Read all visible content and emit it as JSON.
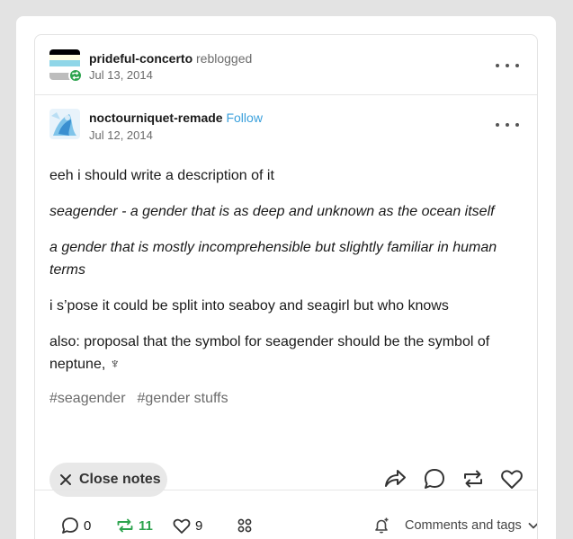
{
  "reblog": {
    "username": "prideful-concerto",
    "action": "reblogged",
    "date": "Jul 13, 2014"
  },
  "original": {
    "username": "noctourniquet-remade",
    "follow_label": "Follow",
    "date": "Jul 12, 2014"
  },
  "post": {
    "paragraphs": [
      "eeh i should write a description of it",
      "seagender - a gender that is as deep and unknown as the ocean itself",
      "a gender that is mostly incomprehensible but slightly familiar in human terms",
      "i s’pose it could be split into seaboy and seagirl but who knows",
      "also: proposal that the symbol for seagender should be the symbol of neptune, ♆"
    ],
    "tags": [
      "#seagender",
      "#gender stuffs"
    ]
  },
  "actions": {
    "close_notes_label": "Close notes",
    "icons": [
      "share-icon",
      "reply-icon",
      "reblog-icon",
      "like-icon"
    ]
  },
  "notes": {
    "replies": "0",
    "reblogs": "11",
    "likes": "9",
    "comments_tags_label": "Comments and tags"
  },
  "colors": {
    "accent_green": "#2ea44f",
    "follow_blue": "#3aa0dc"
  }
}
